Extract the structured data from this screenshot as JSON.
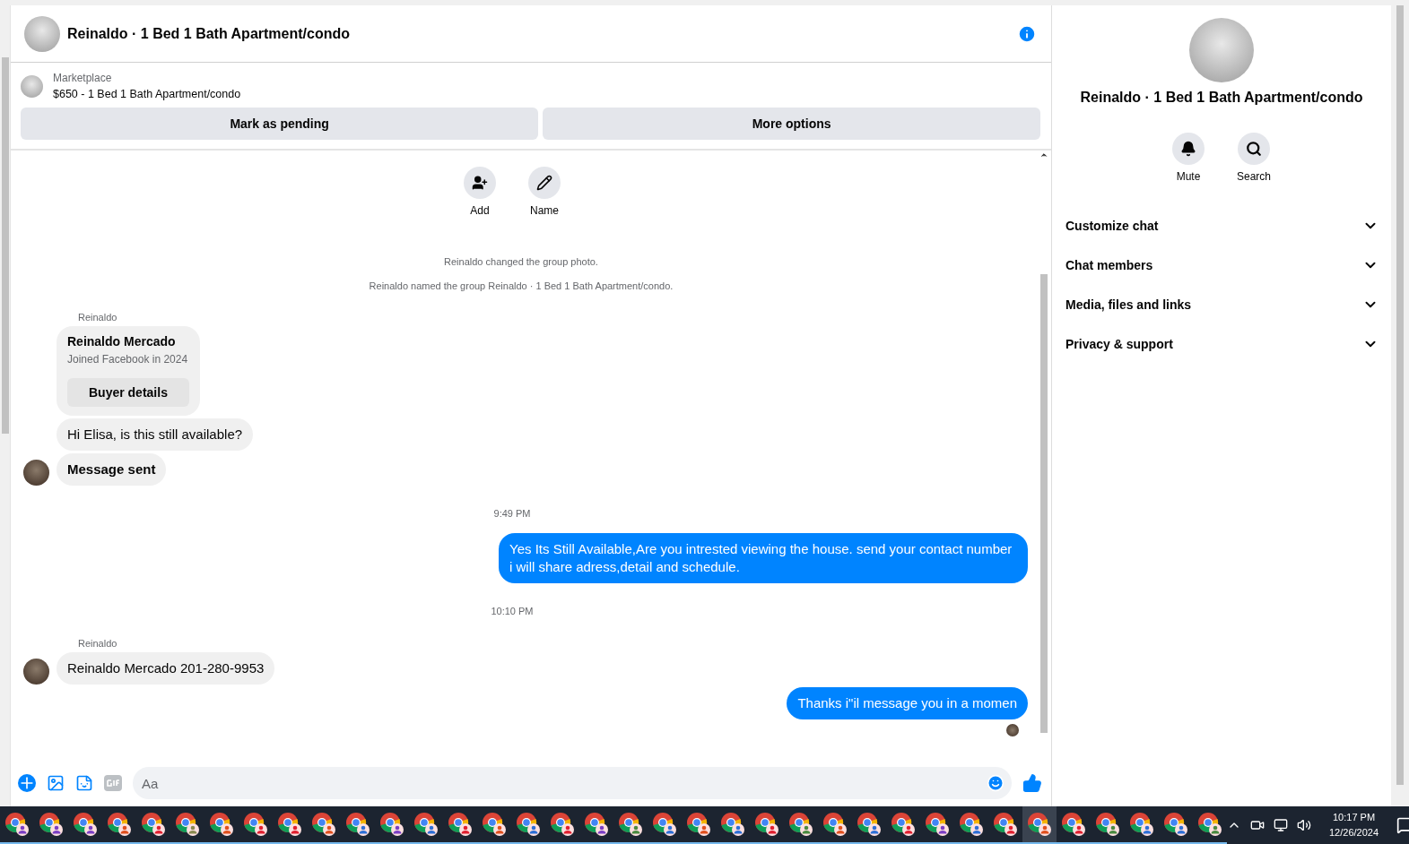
{
  "chat_header": {
    "title": "Reinaldo · 1 Bed 1 Bath Apartment/condo"
  },
  "listing": {
    "source": "Marketplace",
    "title": "$650 - 1 Bed 1 Bath Apartment/condo",
    "buttons": [
      "Mark as pending",
      "More options"
    ]
  },
  "group_actions": [
    {
      "label": "Add",
      "kind": "add"
    },
    {
      "label": "Name",
      "kind": "name"
    }
  ],
  "messages": [
    {
      "kind": "system",
      "text": "Reinaldo changed the group photo."
    },
    {
      "kind": "system",
      "text": "Reinaldo named the group Reinaldo · 1 Bed 1 Bath Apartment/condo."
    },
    {
      "kind": "sender",
      "text": "Reinaldo"
    },
    {
      "kind": "card",
      "title": "Reinaldo Mercado",
      "subtitle": "Joined Facebook in 2024",
      "button": "Buyer details"
    },
    {
      "kind": "incoming",
      "text": "Hi Elisa, is this still available?",
      "avatar": false
    },
    {
      "kind": "incoming",
      "text": "Message sent",
      "avatar": true,
      "bold": true
    },
    {
      "kind": "time",
      "text": "9:49 PM"
    },
    {
      "kind": "outgoing",
      "text": "Yes Its Still Available,Are you intrested viewing the house. send your contact number i will share adress,detail and schedule."
    },
    {
      "kind": "time",
      "text": "10:10 PM"
    },
    {
      "kind": "sender",
      "text": "Reinaldo"
    },
    {
      "kind": "incoming",
      "text": "Reinaldo Mercado 201-280-9953",
      "avatar": true
    },
    {
      "kind": "outgoing",
      "text": "Thanks i\"il message you in a momen",
      "seen": true
    }
  ],
  "composer": {
    "placeholder": "Aa"
  },
  "details_panel": {
    "title": "Reinaldo · 1 Bed 1 Bath Apartment/condo",
    "actions": [
      {
        "label": "Mute",
        "kind": "mute"
      },
      {
        "label": "Search",
        "kind": "search"
      }
    ],
    "sections": [
      {
        "label": "Customize chat",
        "expanded": false
      },
      {
        "label": "Chat members",
        "expanded": false
      },
      {
        "label": "Media, files and links",
        "expanded": false
      },
      {
        "label": "Privacy & support",
        "expanded": false
      }
    ]
  },
  "taskbar": {
    "apps": [
      {
        "color": "#7b3fc4",
        "selected": false
      },
      {
        "color": "#7b3fc4",
        "selected": false
      },
      {
        "color": "#7b3fc4",
        "selected": false
      },
      {
        "color": "#e0501e",
        "selected": false
      },
      {
        "color": "#e02030",
        "selected": false
      },
      {
        "color": "#8a8a50",
        "selected": false
      },
      {
        "color": "#e0501e",
        "selected": false
      },
      {
        "color": "#e02030",
        "selected": false
      },
      {
        "color": "#e02030",
        "selected": false
      },
      {
        "color": "#e0501e",
        "selected": false
      },
      {
        "color": "#2d6fd6",
        "selected": false
      },
      {
        "color": "#7b3fc4",
        "selected": false
      },
      {
        "color": "#2d6fd6",
        "selected": false
      },
      {
        "color": "#e02030",
        "selected": false
      },
      {
        "color": "#e0501e",
        "selected": false
      },
      {
        "color": "#2d6fd6",
        "selected": false
      },
      {
        "color": "#e02030",
        "selected": false
      },
      {
        "color": "#7b3fc4",
        "selected": false
      },
      {
        "color": "#4a8a40",
        "selected": false
      },
      {
        "color": "#2d6fd6",
        "selected": false
      },
      {
        "color": "#e0501e",
        "selected": false
      },
      {
        "color": "#2d6fd6",
        "selected": false
      },
      {
        "color": "#e02030",
        "selected": false
      },
      {
        "color": "#4a8a40",
        "selected": false
      },
      {
        "color": "#e0501e",
        "selected": false
      },
      {
        "color": "#2d6fd6",
        "selected": false
      },
      {
        "color": "#e02030",
        "selected": false
      },
      {
        "color": "#7b3fc4",
        "selected": false
      },
      {
        "color": "#2d6fd6",
        "selected": false
      },
      {
        "color": "#e02030",
        "selected": false
      },
      {
        "color": "#e0501e",
        "selected": true
      },
      {
        "color": "#e02030",
        "selected": false
      },
      {
        "color": "#4a8a40",
        "selected": false
      },
      {
        "color": "#2d6fd6",
        "selected": false
      },
      {
        "color": "#2d6fd6",
        "selected": false
      },
      {
        "color": "#4a8a40",
        "selected": false
      }
    ],
    "time": "10:17 PM",
    "date": "12/26/2024"
  }
}
